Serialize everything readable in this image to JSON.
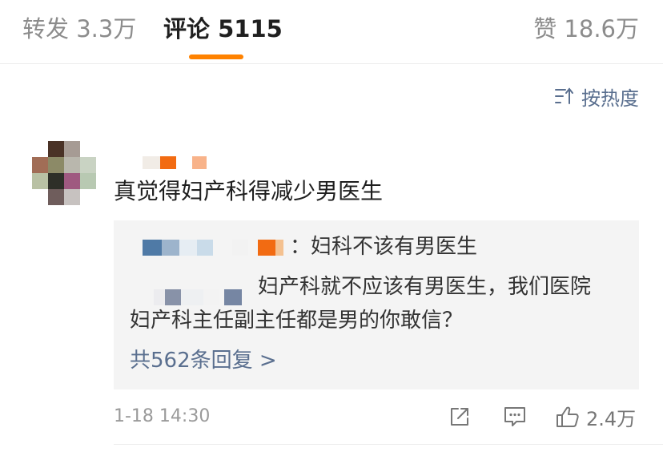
{
  "tabs": {
    "repost": "转发 3.3万",
    "comments": "评论 5115",
    "likes": "赞 18.6万"
  },
  "sort": {
    "label": "按热度",
    "icon": "sort-hot-icon"
  },
  "comment": {
    "text": "真觉得妇产科得减少男医生",
    "replies": [
      {
        "text": "：妇科不该有男医生"
      },
      {
        "text_line1": "妇产科就不应该有男医生，我们医院",
        "text_line2": "妇产科主任副主任都是男的你敢信？"
      }
    ],
    "more_replies": "共562条回复 >",
    "time": "1-18 14:30",
    "likes": "2.4万"
  },
  "colors": {
    "accent": "#ff8200",
    "link": "#5a6f8f",
    "text": "#1f1f1f",
    "muted": "#9a9a9a",
    "reply_bg": "#f4f4f4"
  },
  "icons": [
    "sort-hot-icon",
    "share-icon",
    "comment-icon",
    "like-icon"
  ]
}
